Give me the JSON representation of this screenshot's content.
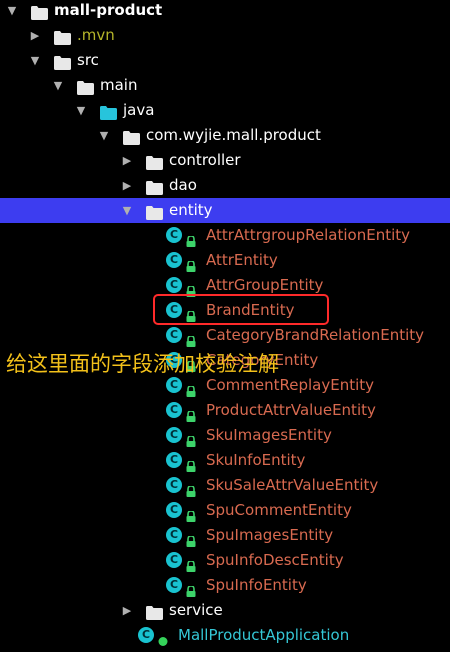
{
  "tree": {
    "items": [
      {
        "label": "mall-product",
        "level": 0,
        "arrow": "down",
        "icon": "module-folder-icon",
        "style": "bold"
      },
      {
        "label": ".mvn",
        "level": 1,
        "arrow": "right",
        "icon": "folder-icon",
        "style": "mvn"
      },
      {
        "label": "src",
        "level": 1,
        "arrow": "down",
        "icon": "folder-icon",
        "style": "normal"
      },
      {
        "label": "main",
        "level": 2,
        "arrow": "down",
        "icon": "folder-icon",
        "style": "normal"
      },
      {
        "label": "java",
        "level": 3,
        "arrow": "down",
        "icon": "source-folder-icon",
        "style": "normal"
      },
      {
        "label": "com.wyjie.mall.product",
        "level": 4,
        "arrow": "down",
        "icon": "package-icon",
        "style": "normal"
      },
      {
        "label": "controller",
        "level": 5,
        "arrow": "right",
        "icon": "package-icon",
        "style": "normal"
      },
      {
        "label": "dao",
        "level": 5,
        "arrow": "right",
        "icon": "package-icon",
        "style": "normal"
      },
      {
        "label": "entity",
        "level": 5,
        "arrow": "down",
        "icon": "package-icon",
        "style": "normal",
        "selected": true
      },
      {
        "label": "AttrAttrgroupRelationEntity",
        "level": 6,
        "icon": "class-icon",
        "style": "entity"
      },
      {
        "label": "AttrEntity",
        "level": 6,
        "icon": "class-icon",
        "style": "entity"
      },
      {
        "label": "AttrGroupEntity",
        "level": 6,
        "icon": "class-icon",
        "style": "entity"
      },
      {
        "label": "BrandEntity",
        "level": 6,
        "icon": "class-icon",
        "style": "entity"
      },
      {
        "label": "CategoryBrandRelationEntity",
        "level": 6,
        "icon": "class-icon",
        "style": "entity"
      },
      {
        "label": "CategoryEntity",
        "level": 6,
        "icon": "class-icon",
        "style": "entity"
      },
      {
        "label": "CommentReplayEntity",
        "level": 6,
        "icon": "class-icon",
        "style": "entity"
      },
      {
        "label": "ProductAttrValueEntity",
        "level": 6,
        "icon": "class-icon",
        "style": "entity"
      },
      {
        "label": "SkuImagesEntity",
        "level": 6,
        "icon": "class-icon",
        "style": "entity"
      },
      {
        "label": "SkuInfoEntity",
        "level": 6,
        "icon": "class-icon",
        "style": "entity"
      },
      {
        "label": "SkuSaleAttrValueEntity",
        "level": 6,
        "icon": "class-icon",
        "style": "entity"
      },
      {
        "label": "SpuCommentEntity",
        "level": 6,
        "icon": "class-icon",
        "style": "entity"
      },
      {
        "label": "SpuImagesEntity",
        "level": 6,
        "icon": "class-icon",
        "style": "entity"
      },
      {
        "label": "SpuInfoDescEntity",
        "level": 6,
        "icon": "class-icon",
        "style": "entity"
      },
      {
        "label": "SpuInfoEntity",
        "level": 6,
        "icon": "class-icon",
        "style": "entity"
      },
      {
        "label": "service",
        "level": 5,
        "arrow": "right",
        "icon": "package-icon",
        "style": "normal"
      },
      {
        "label": "MallProductApplication",
        "level": 5,
        "icon": "spring-app-icon",
        "style": "app"
      }
    ]
  },
  "annotation": {
    "text": "给这里面的字段添加校验注解"
  },
  "colors": {
    "background": "#000000",
    "selected_row": "#3d3df0",
    "entity_text": "#d86a50",
    "app_text": "#35c7d6",
    "annotation": "#f3c11a",
    "highlight_border": "#ff2a2a"
  }
}
